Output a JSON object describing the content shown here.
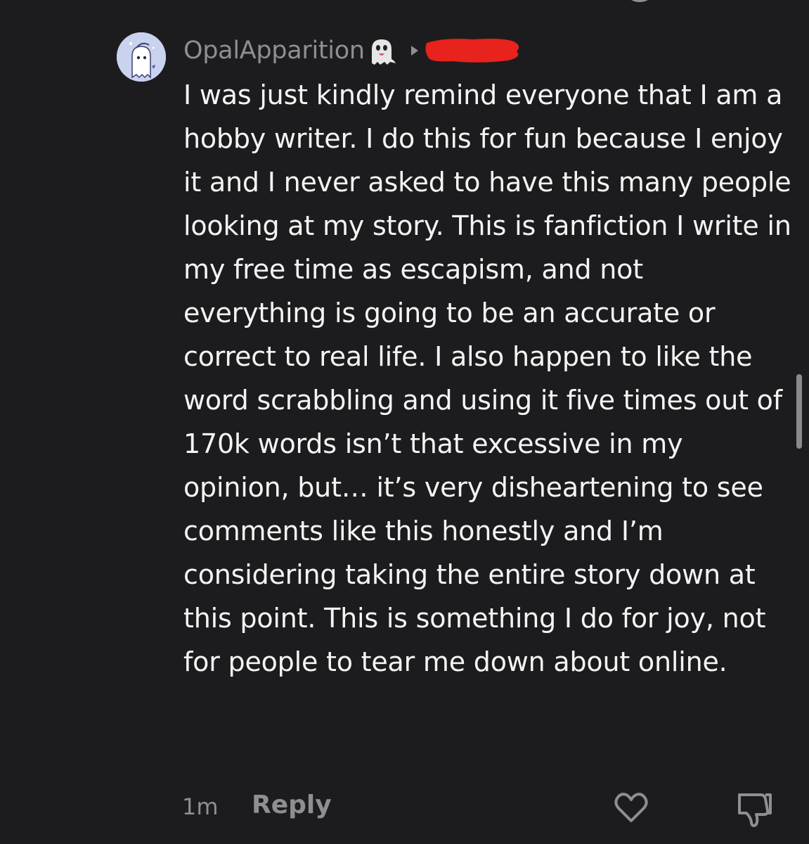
{
  "comment": {
    "username": "OpalApparition",
    "username_emoji": "ghost-emoji",
    "reply_target": "[redacted]",
    "body": "I was just kindly remind everyone that I am a hobby writer. I do this for fun because I enjoy it and I never asked to have this many people looking at my story. This is fanfiction I write in my free time as escapism, and not everything is going to be an accurate or correct to real life. I also happen to like the word scrabbling and using it five times out of 170k words isn’t that excessive in my opinion, but… it’s very disheartening to see comments like this honestly and I’m considering taking the entire story down at this point. This is something I do for joy, not for people to tear me down about online.",
    "timestamp": "1m",
    "reply_label": "Reply"
  },
  "colors": {
    "background": "#1c1c1e",
    "text": "#f4f4f4",
    "muted": "#8e8e93",
    "redaction": "#e8221c",
    "avatar_bg": "#c9d2ee"
  },
  "icons": {
    "like": "heart-icon",
    "dislike": "thumbs-down-icon",
    "caret": "caret-right-icon"
  }
}
